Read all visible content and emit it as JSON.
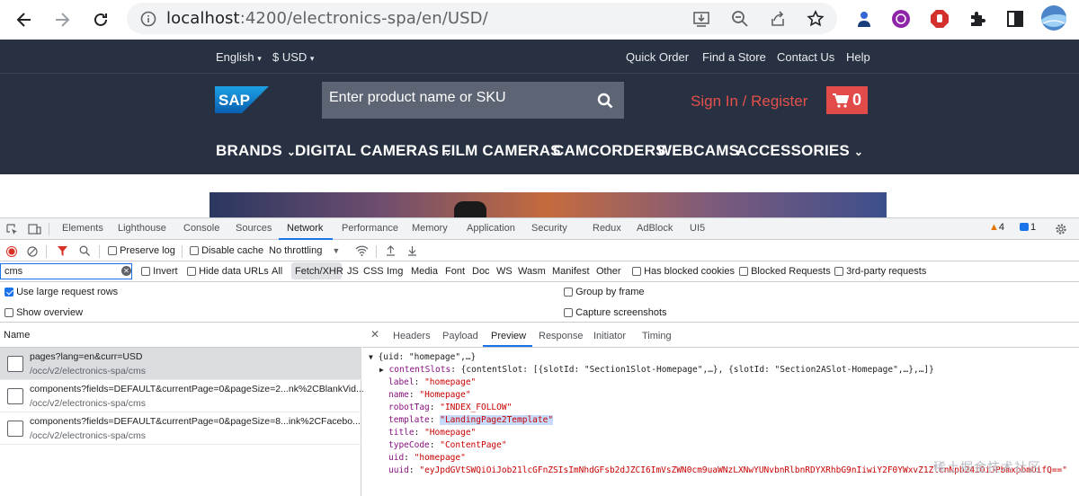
{
  "browser": {
    "url_host": "localhost",
    "url_path": ":4200/electronics-spa/en/USD/",
    "icons": [
      "back-arrow-icon",
      "forward-arrow-icon",
      "reload-icon",
      "info-icon",
      "install-icon",
      "zoom-icon",
      "share-icon",
      "star-icon",
      "ext-person-icon",
      "ext-purple-icon",
      "ext-shield-icon",
      "puzzle-icon",
      "sidepanel-icon",
      "profile-avatar-icon"
    ]
  },
  "site": {
    "language": "English",
    "currency": "$ USD",
    "top_links": [
      "Quick Order",
      "Find a Store",
      "Contact Us",
      "Help"
    ],
    "logo": "SAP",
    "search_placeholder": "Enter product name or SKU",
    "signin": "Sign In / Register",
    "cart_count": "0",
    "nav": [
      "BRANDS",
      "DIGITAL CAMERAS",
      "FILM CAMERAS",
      "CAMCORDERS",
      "WEBCAMS",
      "ACCESSORIES"
    ]
  },
  "devtools": {
    "tabs": [
      "Elements",
      "Lighthouse",
      "Console",
      "Sources",
      "Network",
      "Performance",
      "Memory",
      "Application",
      "Security",
      "Redux",
      "AdBlock",
      "UI5"
    ],
    "active_tab": "Network",
    "warnings": "4",
    "messages": "1",
    "toolbar": {
      "preserve_log": "Preserve log",
      "disable_cache": "Disable cache",
      "throttling": "No throttling"
    },
    "filter": {
      "value": "cms",
      "invert": "Invert",
      "hide_data_urls": "Hide data URLs",
      "types": [
        "All",
        "Fetch/XHR",
        "JS",
        "CSS",
        "Img",
        "Media",
        "Font",
        "Doc",
        "WS",
        "Wasm",
        "Manifest",
        "Other"
      ],
      "blocked_cookies": "Has blocked cookies",
      "blocked_requests": "Blocked Requests",
      "third_party": "3rd-party requests"
    },
    "options": {
      "large_rows": "Use large request rows",
      "overview": "Show overview",
      "group_by_frame": "Group by frame",
      "capture_screenshots": "Capture screenshots"
    },
    "list_header": "Name",
    "requests": [
      {
        "name": "pages?lang=en&curr=USD",
        "path": "/occ/v2/electronics-spa/cms"
      },
      {
        "name": "components?fields=DEFAULT&currentPage=0&pageSize=2...nk%2CBlankVid...",
        "path": "/occ/v2/electronics-spa/cms"
      },
      {
        "name": "components?fields=DEFAULT&currentPage=0&pageSize=8...ink%2CFacebo...",
        "path": "/occ/v2/electronics-spa/cms"
      }
    ],
    "detail_tabs": [
      "Headers",
      "Payload",
      "Preview",
      "Response",
      "Initiator",
      "Timing"
    ],
    "active_detail_tab": "Preview",
    "preview": {
      "root": "{uid: \"homepage\",…}",
      "contentSlots_key": "contentSlots",
      "contentSlots_val": "{contentSlot: [{slotId: \"Section1Slot-Homepage\",…}, {slotId: \"Section2ASlot-Homepage\",…},…]}",
      "lines": [
        {
          "k": "label",
          "v": "\"homepage\""
        },
        {
          "k": "name",
          "v": "\"Homepage\""
        },
        {
          "k": "robotTag",
          "v": "\"INDEX_FOLLOW\""
        },
        {
          "k": "template",
          "v": "\"LandingPage2Template\""
        },
        {
          "k": "title",
          "v": "\"Homepage\""
        },
        {
          "k": "typeCode",
          "v": "\"ContentPage\""
        },
        {
          "k": "uid",
          "v": "\"homepage\""
        },
        {
          "k": "uuid",
          "v": "\"eyJpdGVtSWQiOiJob21lcGFnZSIsImNhdGFsb2dJZCI6ImVsZWN0cm9uaWNzLXNwYUNvbnRlbnRDYXRhbG9nIiwiY2F0YWxvZ1ZlcnNpb24iOiJPbmxpbmUifQ==\""
        }
      ]
    },
    "watermark": "稀土掘金技术社区"
  }
}
